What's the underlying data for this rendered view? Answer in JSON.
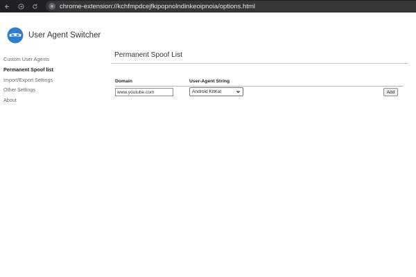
{
  "browser": {
    "url": "chrome-extension://kchfmpdcejfkipopnolndinkeoipnoia/options.html"
  },
  "brand": {
    "title": "User Agent Switcher"
  },
  "sidebar": {
    "items": [
      {
        "label": "Custom User Agents",
        "active": false
      },
      {
        "label": "Permanent Spoof list",
        "active": true
      },
      {
        "label": "Import/Export Settings",
        "active": false
      },
      {
        "label": "Other Settings",
        "active": false
      },
      {
        "label": "About",
        "active": false
      }
    ]
  },
  "main": {
    "title": "Permanent Spoof List",
    "table": {
      "headers": {
        "domain": "Domain",
        "ua": "User-Agent String"
      },
      "row": {
        "domain_value": "www.youtube.com",
        "ua_selected": "Android KitKat",
        "add_label": "Add"
      }
    }
  },
  "icons": {
    "back": "arrow-left-icon",
    "forward": "arrow-right-icon",
    "reload": "reload-icon",
    "site_info": "site-info-icon",
    "logo": "mask-logo-icon",
    "dropdown": "chevron-down-icon"
  },
  "colors": {
    "chrome_bar": "#202124",
    "omnibox": "#35363a",
    "logo_blue": "#2f7fd1"
  }
}
